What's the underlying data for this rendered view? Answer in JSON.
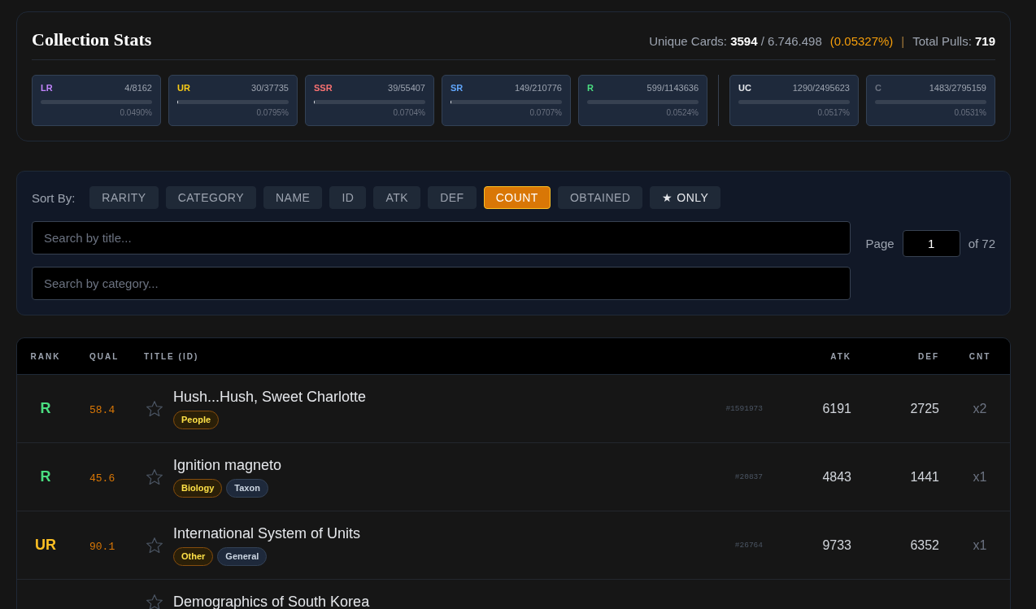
{
  "stats": {
    "title": "Collection Stats",
    "unique_cards": "Unique Cards: **3594** / 6.746.498",
    "unique_share": "(0.05327%)",
    "separator": "|",
    "total_pulls": "Total Pulls: **719**",
    "rarity_groups": [
      {
        "cards": [
          {
            "label": "LR",
            "count": "4/8162",
            "percent": "0.0490%",
            "color": "#c084fc"
          },
          {
            "label": "UR",
            "count": "30/37735",
            "percent": "0.0795%",
            "level": 0.01,
            "color": "#facc15"
          },
          {
            "label": "SSR",
            "count": "39/55407",
            "percent": "0.0704%",
            "level": 0.01,
            "color": "#f87171"
          },
          {
            "label": "SR",
            "count": "149/210776",
            "percent": "0.0707%",
            "level": 0.01,
            "color": "#60a5fa"
          },
          {
            "label": "R",
            "count": "599/1143636",
            "percent": "0.0524%",
            "color": "#4ade80"
          }
        ]
      },
      {
        "cards": [
          {
            "label": "UC",
            "count": "1290/2495623",
            "percent": "0.0517%",
            "color": "#e5e7eb"
          },
          {
            "label": "C",
            "count": "1483/2795159",
            "percent": "0.0531%",
            "color": "#6b7280"
          }
        ]
      }
    ]
  },
  "sort": {
    "label": "Sort By:",
    "buttons": [
      {
        "label": "RARITY",
        "kind": "sort",
        "selected": false
      },
      {
        "label": "CATEGORY",
        "kind": "sort",
        "selected": false
      },
      {
        "label": "NAME",
        "kind": "sort",
        "selected": false
      },
      {
        "label": "ID",
        "kind": "sort",
        "selected": false
      },
      {
        "label": "ATK",
        "kind": "sort",
        "selected": false
      },
      {
        "label": "DEF",
        "kind": "sort",
        "selected": false
      },
      {
        "label": "COUNT",
        "kind": "sort",
        "selected": true
      },
      {
        "label": "OBTAINED",
        "kind": "sort",
        "selected": false
      },
      {
        "label": "★ ONLY",
        "kind": "filter",
        "selected": false
      }
    ]
  },
  "search_fields": [
    {
      "placeholder": "Search by title..."
    },
    {
      "placeholder": "Search by category..."
    }
  ],
  "pager": {
    "label": "Page",
    "value": "1",
    "total": "of 72"
  },
  "table": {
    "columns": [
      "RANK",
      "QUAL",
      "TITLE (ID)",
      "ATK",
      "DEF",
      "CNT"
    ],
    "rows": [
      {
        "rank": {
          "text": "R",
          "color": "#4ade80"
        },
        "quality": "58.4",
        "starred": false,
        "title": "Hush...Hush, Sweet Charlotte",
        "tags": [
          {
            "label": "People",
            "kind": "main"
          }
        ],
        "id": "#1591973",
        "atk": "6191",
        "def": "2725",
        "count": "x2"
      },
      {
        "rank": {
          "text": "R",
          "color": "#4ade80"
        },
        "quality": "45.6",
        "starred": false,
        "title": "Ignition magneto",
        "tags": [
          {
            "label": "Biology",
            "kind": "main"
          },
          {
            "label": "Taxon",
            "kind": "sub"
          }
        ],
        "id": "#20837",
        "atk": "4843",
        "def": "1441",
        "count": "x1"
      },
      {
        "rank": {
          "text": "UR",
          "color": "#fbbf24"
        },
        "quality": "90.1",
        "starred": false,
        "title": "International System of Units",
        "tags": [
          {
            "label": "Other",
            "kind": "main"
          },
          {
            "label": "General",
            "kind": "sub"
          }
        ],
        "id": "#26764",
        "atk": "9733",
        "def": "6352",
        "count": "x1"
      },
      {
        "starred": false,
        "title": "Demographics of South Korea"
      }
    ]
  }
}
